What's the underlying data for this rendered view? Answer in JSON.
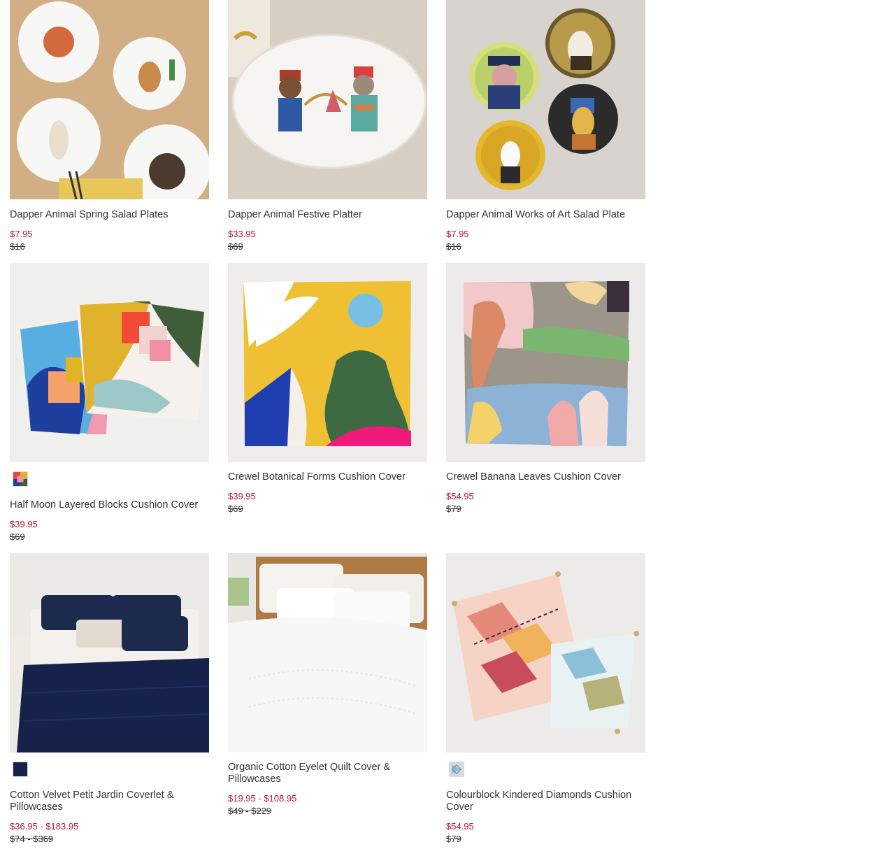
{
  "products": [
    {
      "name": "Dapper Animal Spring Salad Plates",
      "sale_price": "$7.95",
      "original_price": "$16"
    },
    {
      "name": "Dapper Animal Festive Platter",
      "sale_price": "$33.95",
      "original_price": "$69"
    },
    {
      "name": "Dapper Animal Works of Art Salad Plate",
      "sale_price": "$7.95",
      "original_price": "$16"
    },
    {
      "name": "Half Moon Layered Blocks Cushion Cover",
      "sale_price": "$39.95",
      "original_price": "$69",
      "swatch": "multicolor"
    },
    {
      "name": "Crewel Botanical Forms Cushion Cover",
      "sale_price": "$39.95",
      "original_price": "$69"
    },
    {
      "name": "Crewel Banana Leaves Cushion Cover",
      "sale_price": "$54.95",
      "original_price": "$79"
    },
    {
      "name": "Cotton Velvet Petit Jardin Coverlet & Pillowcases",
      "sale_price": "$36.95 - $183.95",
      "original_price": "$74 - $369",
      "swatch": "navy"
    },
    {
      "name": "Organic Cotton Eyelet Quilt Cover & Pillowcases",
      "sale_price": "$19.95 - $108.95",
      "original_price": "$49 - $229"
    },
    {
      "name": "Colourblock Kindered Diamonds Cushion Cover",
      "sale_price": "$54.95",
      "original_price": "$79",
      "swatch": "grey-blue"
    }
  ],
  "colors": {
    "sale": "#b5192f",
    "text": "#333333"
  }
}
